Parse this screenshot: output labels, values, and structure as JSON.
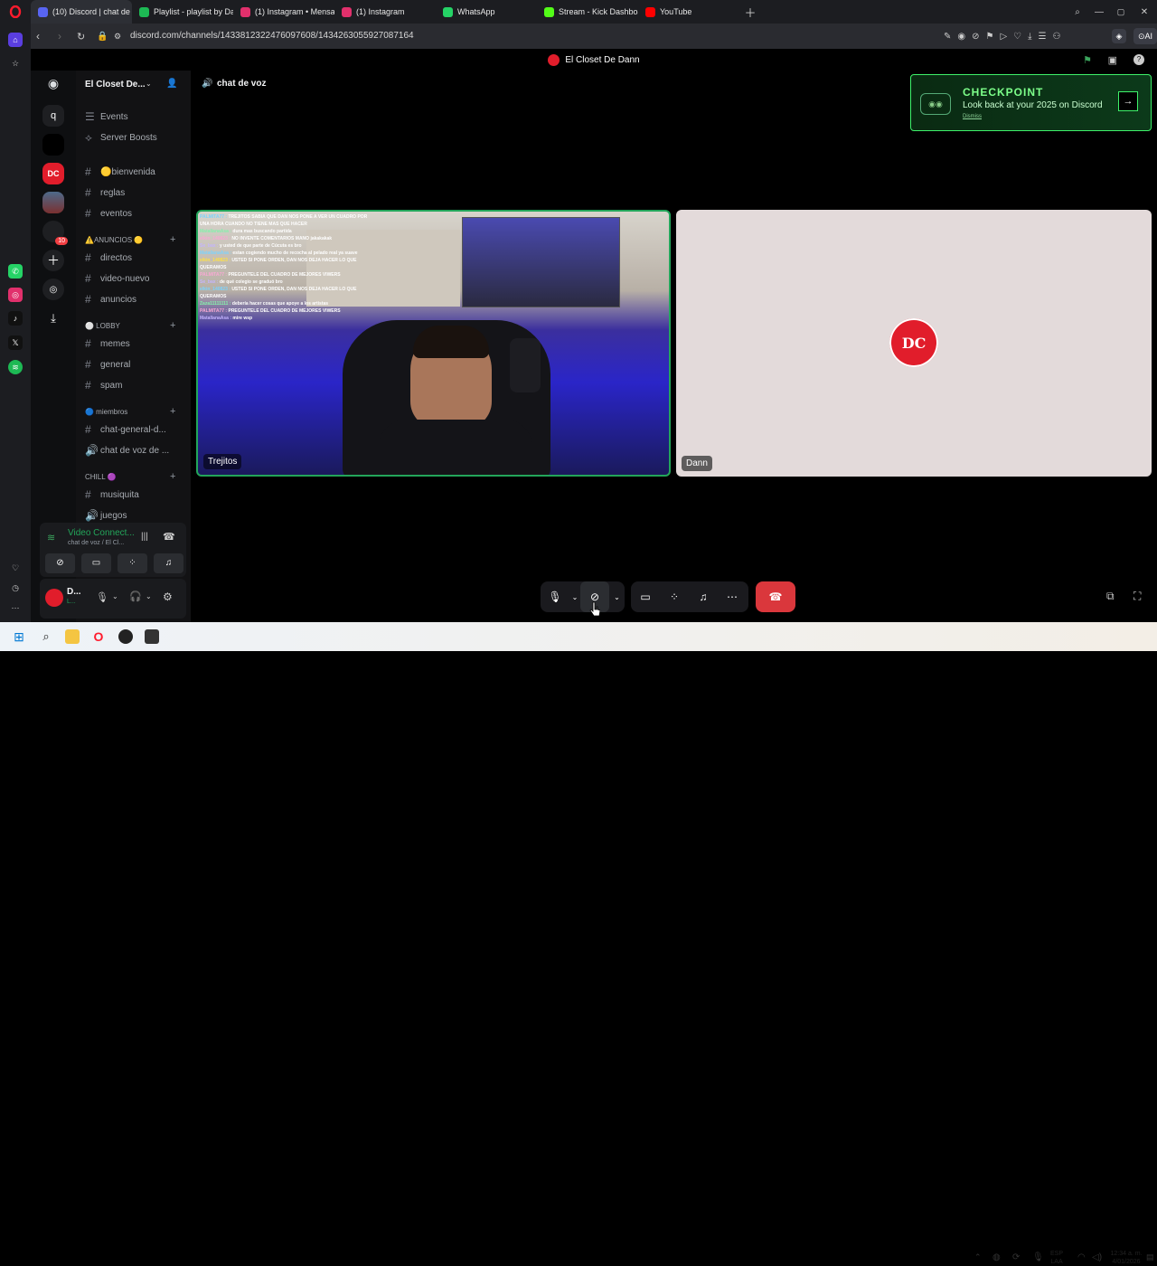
{
  "browser": {
    "tabs": [
      {
        "label": "(10) Discord | chat de",
        "color": "#5865f2",
        "active": true
      },
      {
        "label": "Playlist - playlist by Dairon",
        "color": "#1db954"
      },
      {
        "label": "(1) Instagram • Mensajes",
        "color": "#e1306c"
      },
      {
        "label": "(1) Instagram",
        "color": "#e1306c"
      },
      {
        "label": "WhatsApp",
        "color": "#25d366"
      },
      {
        "label": "Stream - Kick Dashboard",
        "color": "#53fc18"
      },
      {
        "label": "YouTube",
        "color": "#ff0000"
      }
    ],
    "url": "discord.com/channels/1433812322476097608/1434263055927087164",
    "window_title": "El Closet De Dann"
  },
  "discord": {
    "server_name": "El Closet De...",
    "guild_q": "q",
    "badge_count": "10",
    "top_items": [
      "Events",
      "Server Boosts"
    ],
    "channels_top": [
      {
        "label": "🟡bienvenida"
      },
      {
        "label": "reglas"
      },
      {
        "label": "eventos"
      }
    ],
    "cat_anuncios": "⚠️ANUNCIOS 🟡",
    "channels_anuncios": [
      "directos",
      "video-nuevo",
      "anuncios"
    ],
    "cat_lobby": "⚪ LOBBY",
    "channels_lobby": [
      "memes",
      "general",
      "spam"
    ],
    "cat_miembros": "🔵 miembros",
    "channels_miembros": [
      "chat-general-d...",
      "chat de voz de ..."
    ],
    "cat_chill": "CHILL 🟣",
    "channels_chill": [
      "musiquita",
      "juegos"
    ],
    "voice_status": "Video Connect...",
    "voice_sub": "chat de voz / El Cl...",
    "user_short": "D...",
    "user_status": "L..."
  },
  "call": {
    "channel_title": "chat de voz",
    "participants": [
      {
        "name": "Trejitos"
      },
      {
        "name": "Dann"
      }
    ],
    "avatar_text": "DC",
    "checkpoint": {
      "title": "CHECKPOINT",
      "subtitle": "Look back at your 2025 on Discord",
      "dismiss": "Dismiss"
    },
    "chat_overlay": [
      {
        "user": "PALMITA77 :",
        "text": "TREJITOS SABIA QUE DAN NOS PONE A VER UN CUADRO POR"
      },
      {
        "user": "",
        "text": "UNA HORA CUANDO NO TIENE MAS QUE HACER"
      },
      {
        "user": "MatallanaAsa :",
        "text": "dura mas buscando partida"
      },
      {
        "user": "elkin_140823 :",
        "text": "NO INVENTE COMENTARIOS MANO jakakakak"
      },
      {
        "user": "Se_bax :",
        "text": "y usted de que parte de Cúcuta es bro"
      },
      {
        "user": "MatallanaAsa :",
        "text": "estan cogiendo mucho de recocha al pelado real ya suave"
      },
      {
        "user": "elkin_140823 :",
        "text": "USTED SI PONE ORDEN, DAN NOS DEJA HACER LO QUE"
      },
      {
        "user": "",
        "text": "QUERAMOS"
      },
      {
        "user": "PALMITA77 :",
        "text": "PREGUNTELE DEL CUADRO DE MEJORES VIWERS"
      },
      {
        "user": "Se_bax :",
        "text": "de qué colegio se graduó bro"
      },
      {
        "user": "elkin_140823 :",
        "text": "USTED SI PONE ORDEN, DAN NOS DEJA HACER LO QUE"
      },
      {
        "user": "",
        "text": "QUERAMOS"
      },
      {
        "user": "Zaza11111111 :",
        "text": "debería hacer cosas que apoye a los artistas"
      },
      {
        "user": "PALMITA77 :",
        "text": "PREGUNTELE DEL CUADRO DE MEJORES VIWERS"
      },
      {
        "user": "MatallanaAsa :",
        "text": "mire wsp"
      }
    ]
  },
  "taskbar": {
    "lang": "ESP",
    "lang2": "LAA",
    "time": "12:34 a. m.",
    "date": "4/01/2026"
  }
}
